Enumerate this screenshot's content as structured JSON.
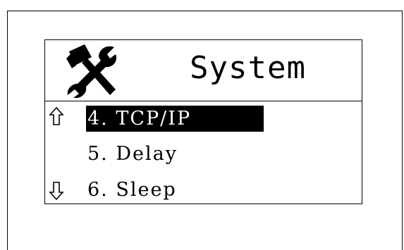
{
  "screen": {
    "title": "System",
    "title_icon": "tools-icon",
    "scroll_up_icon": "arrow-up-icon",
    "scroll_down_icon": "arrow-down-icon",
    "menu": {
      "items": [
        {
          "label": "4. TCP/IP",
          "selected": true
        },
        {
          "label": "5. Delay",
          "selected": false
        },
        {
          "label": "6. Sleep",
          "selected": false
        }
      ]
    }
  },
  "colors": {
    "background": "#ffffff",
    "foreground": "#000000",
    "selection_background": "#000000",
    "selection_text": "#ffffff"
  }
}
